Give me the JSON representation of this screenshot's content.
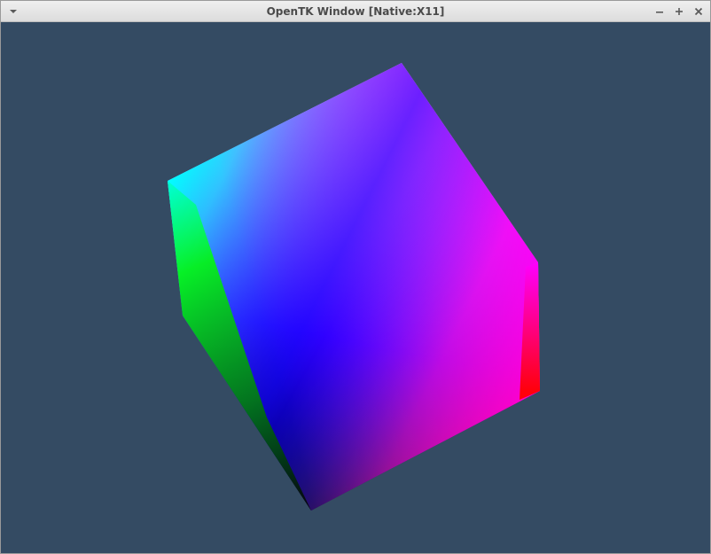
{
  "window": {
    "title": "OpenTK Window [Native:X11]",
    "icons": {
      "menu": "dropdown-arrow-icon",
      "minimize": "minimize-icon",
      "maximize": "maximize-icon",
      "close": "close-icon"
    }
  },
  "scene": {
    "background_color": "#344b63",
    "object": "rgb-color-cube",
    "face_colors": {
      "top": "#ffffff",
      "cyan": "#00ffff",
      "magenta": "#ff00ff",
      "blue": "#0000ff",
      "green": "#00ff00",
      "red": "#ff0000",
      "black": "#000000"
    }
  }
}
